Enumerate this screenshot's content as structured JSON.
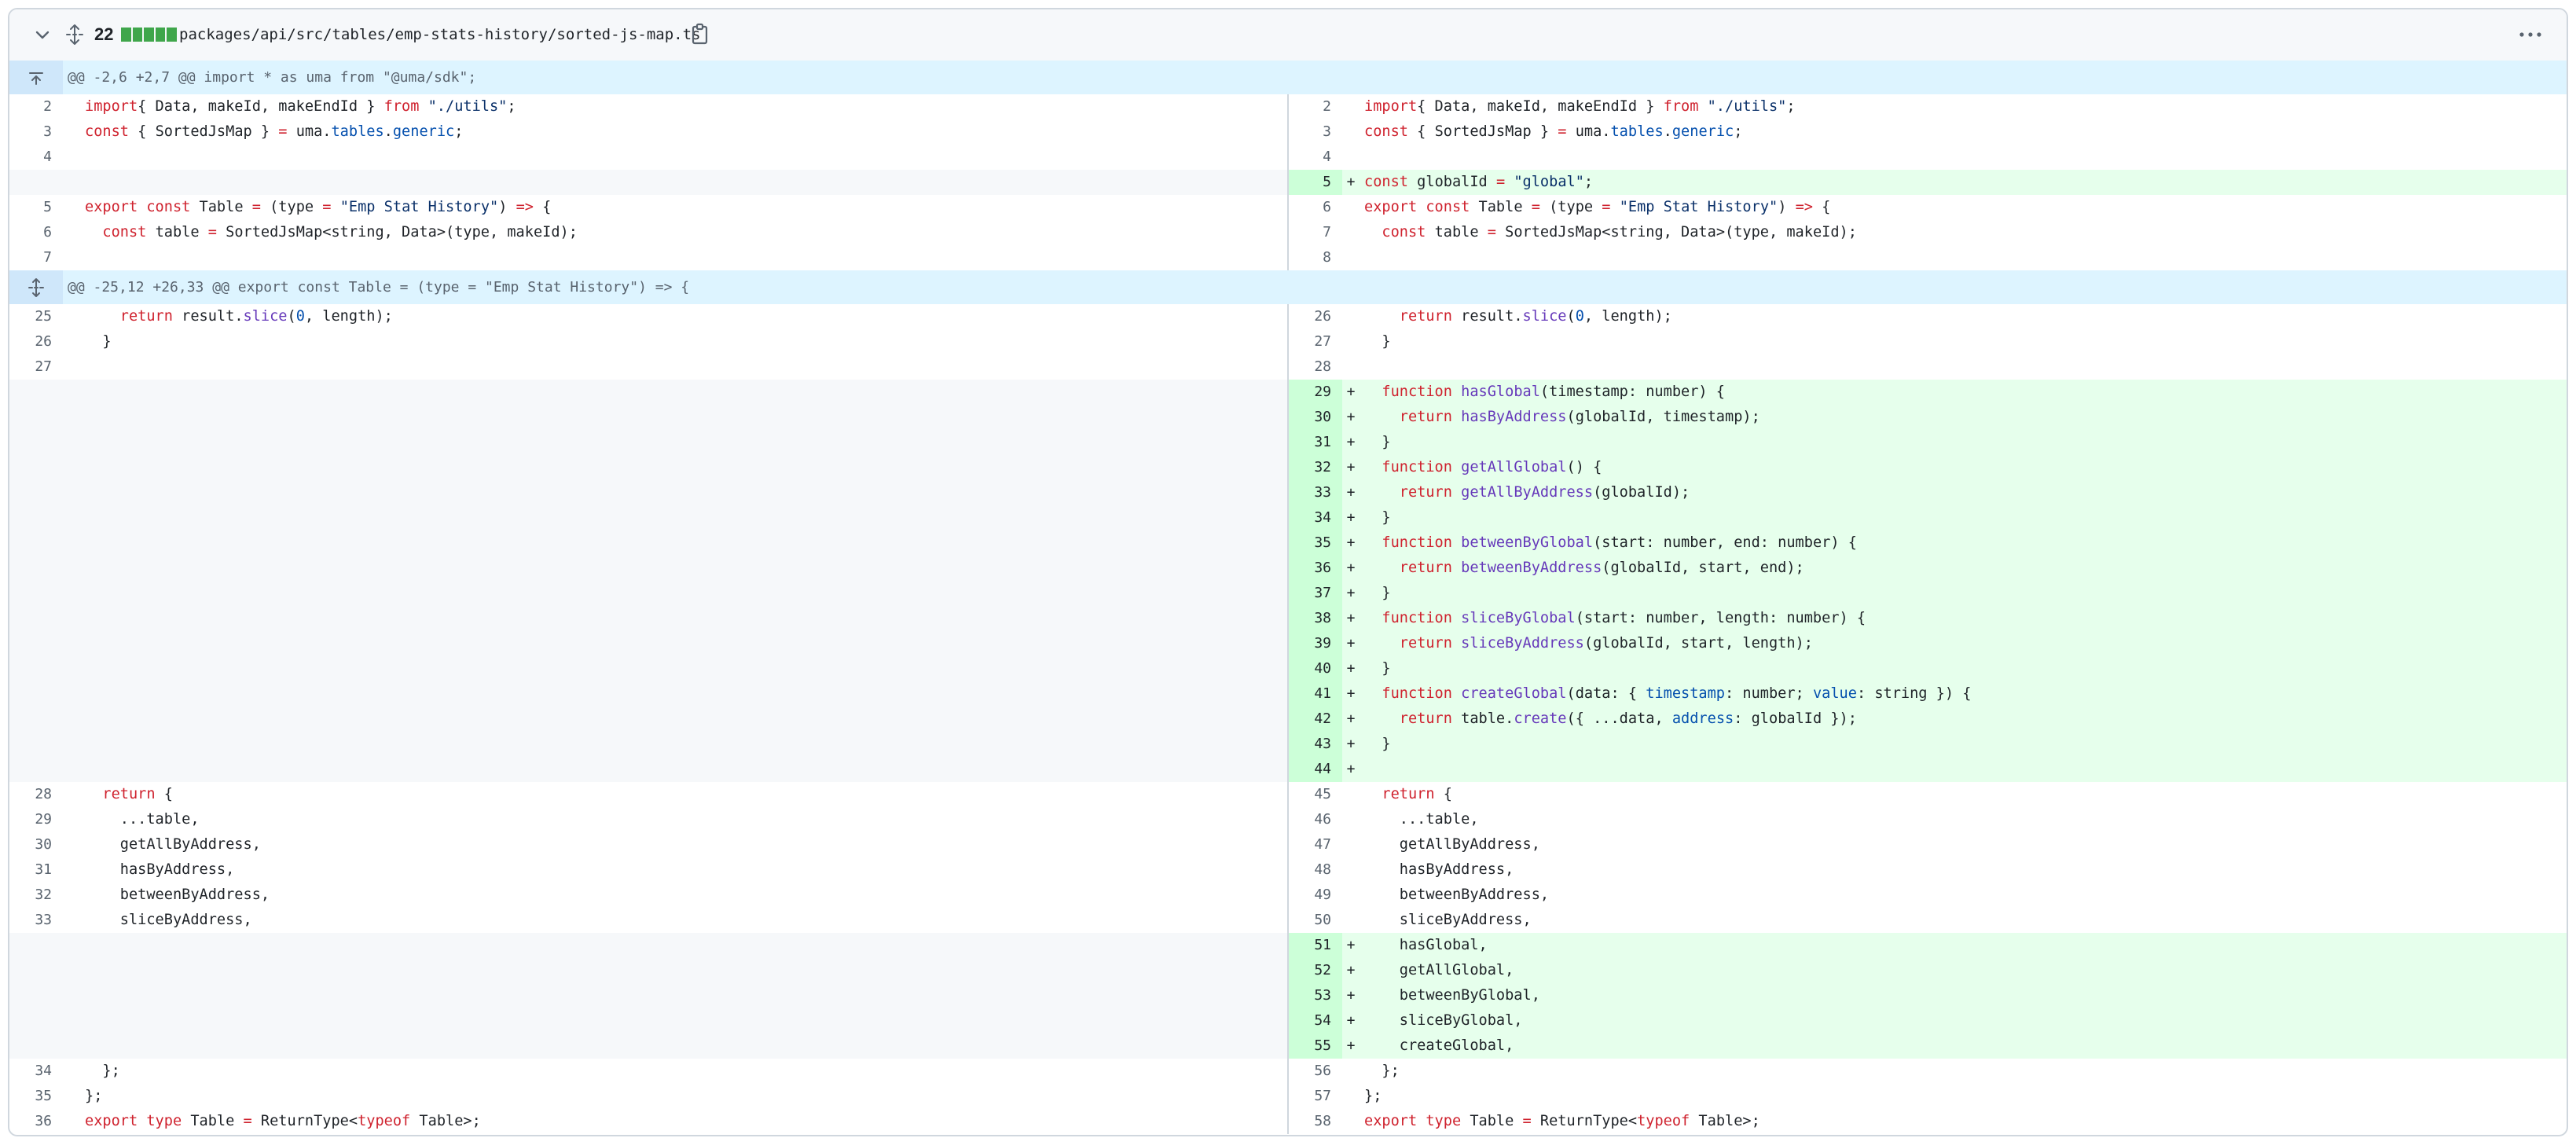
{
  "file_header": {
    "changes_count": "22",
    "diffstat_blocks": 5,
    "path": "packages/api/src/tables/emp-stats-history/sorted-js-map.ts",
    "icons": {
      "collapse": "chevron-down-icon",
      "expand": "unfold-icon",
      "copy": "copy-icon",
      "more": "kebab-horizontal-icon"
    },
    "colors": {
      "added": "#3fa64b",
      "add_bg": "#e6ffec",
      "add_num_bg": "#ccffd8",
      "hunk_bg": "#ddf4ff"
    }
  },
  "rows": [
    {
      "type": "hunk",
      "icon": "expand-up-icon",
      "text": "@@ -2,6 +2,7 @@ import * as uma from \"@uma/sdk\";"
    },
    {
      "type": "line",
      "left": {
        "num": "2",
        "code": [
          [
            "k",
            "import"
          ],
          [
            "",
            "{ Data, makeId, makeEndId } "
          ],
          [
            "k",
            "from"
          ],
          [
            "",
            " "
          ],
          [
            "s",
            "\"./utils\""
          ],
          [
            "",
            ";"
          ]
        ]
      },
      "right": {
        "num": "2",
        "code": [
          [
            "k",
            "import"
          ],
          [
            "",
            "{ Data, makeId, makeEndId } "
          ],
          [
            "k",
            "from"
          ],
          [
            "",
            " "
          ],
          [
            "s",
            "\"./utils\""
          ],
          [
            "",
            ";"
          ]
        ]
      }
    },
    {
      "type": "line",
      "left": {
        "num": "3",
        "code": [
          [
            "k",
            "const"
          ],
          [
            "",
            " { SortedJsMap } "
          ],
          [
            "k",
            "="
          ],
          [
            "",
            " uma."
          ],
          [
            "p",
            "tables"
          ],
          [
            "",
            "."
          ],
          [
            "p",
            "generic"
          ],
          [
            "",
            ";"
          ]
        ]
      },
      "right": {
        "num": "3",
        "code": [
          [
            "k",
            "const"
          ],
          [
            "",
            " { SortedJsMap } "
          ],
          [
            "k",
            "="
          ],
          [
            "",
            " uma."
          ],
          [
            "p",
            "tables"
          ],
          [
            "",
            "."
          ],
          [
            "p",
            "generic"
          ],
          [
            "",
            ";"
          ]
        ]
      }
    },
    {
      "type": "line",
      "left": {
        "num": "4",
        "code": []
      },
      "right": {
        "num": "4",
        "code": []
      }
    },
    {
      "type": "line",
      "left": null,
      "right": {
        "num": "5",
        "add": true,
        "code": [
          [
            "k",
            "const"
          ],
          [
            "",
            " globalId "
          ],
          [
            "k",
            "="
          ],
          [
            "",
            " "
          ],
          [
            "s",
            "\"global\""
          ],
          [
            "",
            ";"
          ]
        ]
      }
    },
    {
      "type": "line",
      "left": {
        "num": "5",
        "code": [
          [
            "k",
            "export const"
          ],
          [
            "",
            " Table "
          ],
          [
            "k",
            "="
          ],
          [
            "",
            " (type "
          ],
          [
            "k",
            "="
          ],
          [
            "",
            " "
          ],
          [
            "s",
            "\"Emp Stat History\""
          ],
          [
            "",
            ") "
          ],
          [
            "k",
            "=>"
          ],
          [
            "",
            " {"
          ]
        ]
      },
      "right": {
        "num": "6",
        "code": [
          [
            "k",
            "export const"
          ],
          [
            "",
            " Table "
          ],
          [
            "k",
            "="
          ],
          [
            "",
            " (type "
          ],
          [
            "k",
            "="
          ],
          [
            "",
            " "
          ],
          [
            "s",
            "\"Emp Stat History\""
          ],
          [
            "",
            ") "
          ],
          [
            "k",
            "=>"
          ],
          [
            "",
            " {"
          ]
        ]
      }
    },
    {
      "type": "line",
      "left": {
        "num": "6",
        "code": [
          [
            "",
            "  "
          ],
          [
            "k",
            "const"
          ],
          [
            "",
            " table "
          ],
          [
            "k",
            "="
          ],
          [
            "",
            " SortedJsMap<string, Data>(type, makeId);"
          ]
        ]
      },
      "right": {
        "num": "7",
        "code": [
          [
            "",
            "  "
          ],
          [
            "k",
            "const"
          ],
          [
            "",
            " table "
          ],
          [
            "k",
            "="
          ],
          [
            "",
            " SortedJsMap<string, Data>(type, makeId);"
          ]
        ]
      }
    },
    {
      "type": "line",
      "left": {
        "num": "7",
        "code": []
      },
      "right": {
        "num": "8",
        "code": []
      }
    },
    {
      "type": "hunk",
      "icon": "unfold-icon",
      "text": "@@ -25,12 +26,33 @@ export const Table = (type = \"Emp Stat History\") => {"
    },
    {
      "type": "line",
      "left": {
        "num": "25",
        "code": [
          [
            "",
            "    "
          ],
          [
            "k",
            "return"
          ],
          [
            "",
            " result."
          ],
          [
            "f",
            "slice"
          ],
          [
            "",
            "("
          ],
          [
            "n",
            "0"
          ],
          [
            "",
            ", length);"
          ]
        ]
      },
      "right": {
        "num": "26",
        "code": [
          [
            "",
            "    "
          ],
          [
            "k",
            "return"
          ],
          [
            "",
            " result."
          ],
          [
            "f",
            "slice"
          ],
          [
            "",
            "("
          ],
          [
            "n",
            "0"
          ],
          [
            "",
            ", length);"
          ]
        ]
      }
    },
    {
      "type": "line",
      "left": {
        "num": "26",
        "code": [
          [
            "",
            "  }"
          ]
        ]
      },
      "right": {
        "num": "27",
        "code": [
          [
            "",
            "  }"
          ]
        ]
      }
    },
    {
      "type": "line",
      "left": {
        "num": "27",
        "code": []
      },
      "right": {
        "num": "28",
        "code": []
      }
    },
    {
      "type": "line",
      "left": null,
      "right": {
        "num": "29",
        "add": true,
        "code": [
          [
            "",
            "  "
          ],
          [
            "k",
            "function"
          ],
          [
            "",
            " "
          ],
          [
            "f",
            "hasGlobal"
          ],
          [
            "",
            "(timestamp: number) {"
          ]
        ]
      }
    },
    {
      "type": "line",
      "left": null,
      "right": {
        "num": "30",
        "add": true,
        "code": [
          [
            "",
            "    "
          ],
          [
            "k",
            "return"
          ],
          [
            "",
            " "
          ],
          [
            "f",
            "hasByAddress"
          ],
          [
            "",
            "(globalId, timestamp);"
          ]
        ]
      }
    },
    {
      "type": "line",
      "left": null,
      "right": {
        "num": "31",
        "add": true,
        "code": [
          [
            "",
            "  }"
          ]
        ]
      }
    },
    {
      "type": "line",
      "left": null,
      "right": {
        "num": "32",
        "add": true,
        "code": [
          [
            "",
            "  "
          ],
          [
            "k",
            "function"
          ],
          [
            "",
            " "
          ],
          [
            "f",
            "getAllGlobal"
          ],
          [
            "",
            "() {"
          ]
        ]
      }
    },
    {
      "type": "line",
      "left": null,
      "right": {
        "num": "33",
        "add": true,
        "code": [
          [
            "",
            "    "
          ],
          [
            "k",
            "return"
          ],
          [
            "",
            " "
          ],
          [
            "f",
            "getAllByAddress"
          ],
          [
            "",
            "(globalId);"
          ]
        ]
      }
    },
    {
      "type": "line",
      "left": null,
      "right": {
        "num": "34",
        "add": true,
        "code": [
          [
            "",
            "  }"
          ]
        ]
      }
    },
    {
      "type": "line",
      "left": null,
      "right": {
        "num": "35",
        "add": true,
        "code": [
          [
            "",
            "  "
          ],
          [
            "k",
            "function"
          ],
          [
            "",
            " "
          ],
          [
            "f",
            "betweenByGlobal"
          ],
          [
            "",
            "(start: number, end: number) {"
          ]
        ]
      }
    },
    {
      "type": "line",
      "left": null,
      "right": {
        "num": "36",
        "add": true,
        "code": [
          [
            "",
            "    "
          ],
          [
            "k",
            "return"
          ],
          [
            "",
            " "
          ],
          [
            "f",
            "betweenByAddress"
          ],
          [
            "",
            "(globalId, start, end);"
          ]
        ]
      }
    },
    {
      "type": "line",
      "left": null,
      "right": {
        "num": "37",
        "add": true,
        "code": [
          [
            "",
            "  }"
          ]
        ]
      }
    },
    {
      "type": "line",
      "left": null,
      "right": {
        "num": "38",
        "add": true,
        "code": [
          [
            "",
            "  "
          ],
          [
            "k",
            "function"
          ],
          [
            "",
            " "
          ],
          [
            "f",
            "sliceByGlobal"
          ],
          [
            "",
            "(start: number, length: number) {"
          ]
        ]
      }
    },
    {
      "type": "line",
      "left": null,
      "right": {
        "num": "39",
        "add": true,
        "code": [
          [
            "",
            "    "
          ],
          [
            "k",
            "return"
          ],
          [
            "",
            " "
          ],
          [
            "f",
            "sliceByAddress"
          ],
          [
            "",
            "(globalId, start, length);"
          ]
        ]
      }
    },
    {
      "type": "line",
      "left": null,
      "right": {
        "num": "40",
        "add": true,
        "code": [
          [
            "",
            "  }"
          ]
        ]
      }
    },
    {
      "type": "line",
      "left": null,
      "right": {
        "num": "41",
        "add": true,
        "code": [
          [
            "",
            "  "
          ],
          [
            "k",
            "function"
          ],
          [
            "",
            " "
          ],
          [
            "f",
            "createGlobal"
          ],
          [
            "",
            "(data: { "
          ],
          [
            "p",
            "timestamp"
          ],
          [
            "",
            ": number; "
          ],
          [
            "p",
            "value"
          ],
          [
            "",
            ": string }) {"
          ]
        ]
      }
    },
    {
      "type": "line",
      "left": null,
      "right": {
        "num": "42",
        "add": true,
        "code": [
          [
            "",
            "    "
          ],
          [
            "k",
            "return"
          ],
          [
            "",
            " table."
          ],
          [
            "f",
            "create"
          ],
          [
            "",
            "({ ...data, "
          ],
          [
            "p",
            "address"
          ],
          [
            "",
            ": globalId });"
          ]
        ]
      }
    },
    {
      "type": "line",
      "left": null,
      "right": {
        "num": "43",
        "add": true,
        "code": [
          [
            "",
            "  }"
          ]
        ]
      }
    },
    {
      "type": "line",
      "left": null,
      "right": {
        "num": "44",
        "add": true,
        "code": []
      }
    },
    {
      "type": "line",
      "left": {
        "num": "28",
        "code": [
          [
            "",
            "  "
          ],
          [
            "k",
            "return"
          ],
          [
            "",
            " {"
          ]
        ]
      },
      "right": {
        "num": "45",
        "code": [
          [
            "",
            "  "
          ],
          [
            "k",
            "return"
          ],
          [
            "",
            " {"
          ]
        ]
      }
    },
    {
      "type": "line",
      "left": {
        "num": "29",
        "code": [
          [
            "",
            "    ...table,"
          ]
        ]
      },
      "right": {
        "num": "46",
        "code": [
          [
            "",
            "    ...table,"
          ]
        ]
      }
    },
    {
      "type": "line",
      "left": {
        "num": "30",
        "code": [
          [
            "",
            "    getAllByAddress,"
          ]
        ]
      },
      "right": {
        "num": "47",
        "code": [
          [
            "",
            "    getAllByAddress,"
          ]
        ]
      }
    },
    {
      "type": "line",
      "left": {
        "num": "31",
        "code": [
          [
            "",
            "    hasByAddress,"
          ]
        ]
      },
      "right": {
        "num": "48",
        "code": [
          [
            "",
            "    hasByAddress,"
          ]
        ]
      }
    },
    {
      "type": "line",
      "left": {
        "num": "32",
        "code": [
          [
            "",
            "    betweenByAddress,"
          ]
        ]
      },
      "right": {
        "num": "49",
        "code": [
          [
            "",
            "    betweenByAddress,"
          ]
        ]
      }
    },
    {
      "type": "line",
      "left": {
        "num": "33",
        "code": [
          [
            "",
            "    sliceByAddress,"
          ]
        ]
      },
      "right": {
        "num": "50",
        "code": [
          [
            "",
            "    sliceByAddress,"
          ]
        ]
      }
    },
    {
      "type": "line",
      "left": null,
      "right": {
        "num": "51",
        "add": true,
        "code": [
          [
            "",
            "    hasGlobal,"
          ]
        ]
      }
    },
    {
      "type": "line",
      "left": null,
      "right": {
        "num": "52",
        "add": true,
        "code": [
          [
            "",
            "    getAllGlobal,"
          ]
        ]
      }
    },
    {
      "type": "line",
      "left": null,
      "right": {
        "num": "53",
        "add": true,
        "code": [
          [
            "",
            "    betweenByGlobal,"
          ]
        ]
      }
    },
    {
      "type": "line",
      "left": null,
      "right": {
        "num": "54",
        "add": true,
        "code": [
          [
            "",
            "    sliceByGlobal,"
          ]
        ]
      }
    },
    {
      "type": "line",
      "left": null,
      "right": {
        "num": "55",
        "add": true,
        "code": [
          [
            "",
            "    createGlobal,"
          ]
        ]
      }
    },
    {
      "type": "line",
      "left": {
        "num": "34",
        "code": [
          [
            "",
            "  };"
          ]
        ]
      },
      "right": {
        "num": "56",
        "code": [
          [
            "",
            "  };"
          ]
        ]
      }
    },
    {
      "type": "line",
      "left": {
        "num": "35",
        "code": [
          [
            "",
            "};"
          ]
        ]
      },
      "right": {
        "num": "57",
        "code": [
          [
            "",
            "};"
          ]
        ]
      }
    },
    {
      "type": "line",
      "left": {
        "num": "36",
        "code": [
          [
            "k",
            "export type"
          ],
          [
            "",
            " Table "
          ],
          [
            "k",
            "="
          ],
          [
            "",
            " ReturnType<"
          ],
          [
            "k",
            "typeof"
          ],
          [
            "",
            " Table>;"
          ]
        ]
      },
      "right": {
        "num": "58",
        "code": [
          [
            "k",
            "export type"
          ],
          [
            "",
            " Table "
          ],
          [
            "k",
            "="
          ],
          [
            "",
            " ReturnType<"
          ],
          [
            "k",
            "typeof"
          ],
          [
            "",
            " Table>;"
          ]
        ]
      }
    }
  ]
}
